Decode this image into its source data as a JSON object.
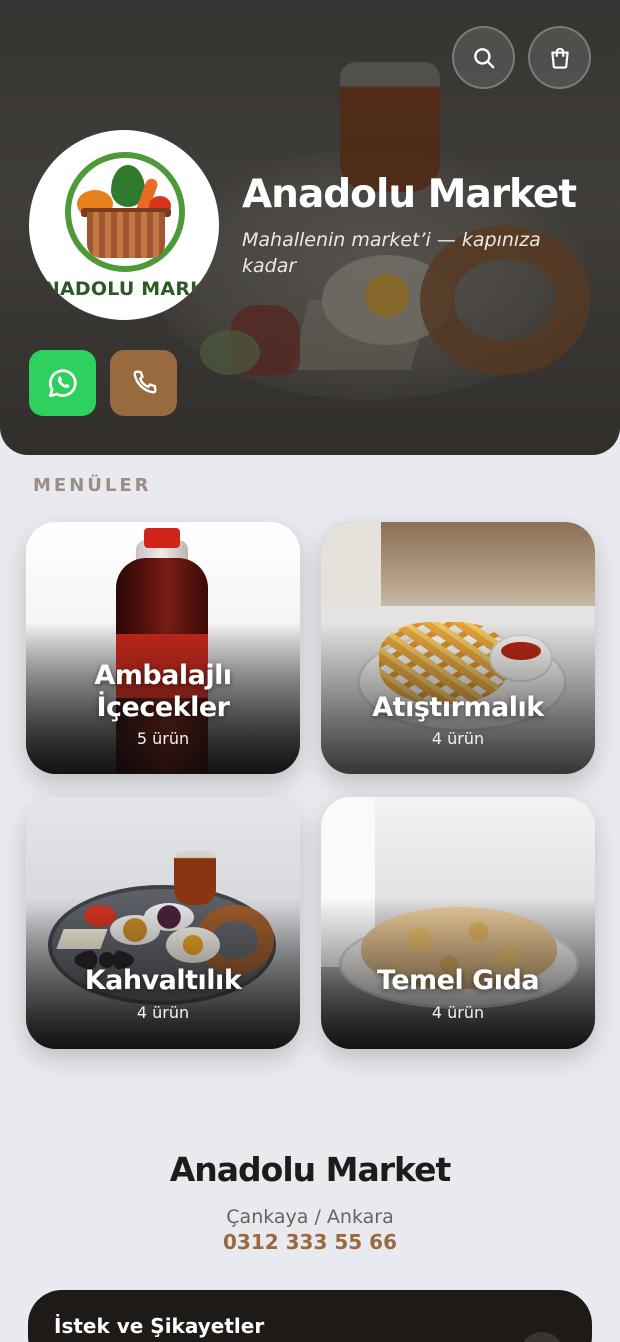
{
  "header": {
    "brand_name": "Anadolu Market",
    "tagline": "Mahallenin market’i — kapınıza kadar",
    "logo_text": "ANADOLU MARKET",
    "search_icon": "search-icon",
    "cart_icon": "shopping-bag-icon",
    "whatsapp_icon": "whatsapp-icon",
    "phone_icon": "phone-icon"
  },
  "menus": {
    "section_label": "MENÜLER",
    "items": [
      {
        "title": "Ambalajlı İçecekler",
        "count": "5 ürün"
      },
      {
        "title": "Atıştırmalık",
        "count": "4 ürün"
      },
      {
        "title": "Kahvaltılık",
        "count": "4 ürün"
      },
      {
        "title": "Temel Gıda",
        "count": "4 ürün"
      }
    ]
  },
  "info": {
    "title": "Anadolu Market",
    "location": "Çankaya / Ankara",
    "phone": "0312 333 55 66"
  },
  "feedback": {
    "label": "İstek ve Şikayetler"
  },
  "colors": {
    "whatsapp": "#2ed15e",
    "phone_button": "#9a6a3f",
    "accent": "#9a6a3f",
    "page_bg": "#e8eaef"
  }
}
